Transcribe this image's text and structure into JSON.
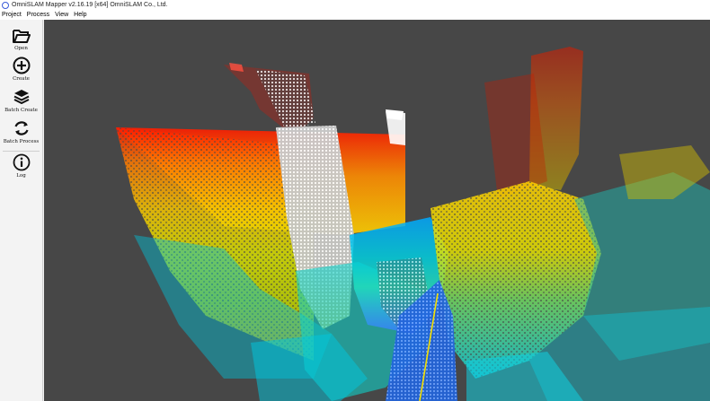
{
  "window": {
    "title": "OmniSLAM Mapper v2.16.19 [x64]   OmniSLAM Co., Ltd."
  },
  "menu": [
    "Project",
    "Process",
    "View",
    "Help"
  ],
  "toolbar": [
    {
      "label": "Open",
      "icon": "folder-open-icon"
    },
    {
      "label": "Create",
      "icon": "plus-circle-icon"
    },
    {
      "label": "Batch Create",
      "icon": "layers-icon"
    },
    {
      "label": "Batch Process",
      "icon": "refresh-icon"
    },
    {
      "label": "Log",
      "icon": "info-icon"
    }
  ],
  "colors": {
    "viewport_bg": "#474747",
    "sidebar_bg": "#f3f3f3",
    "point_high": "#ff1a00",
    "point_mid": "#ffd000",
    "point_low": "#00c8e8",
    "point_ground": "#1a6cff"
  }
}
